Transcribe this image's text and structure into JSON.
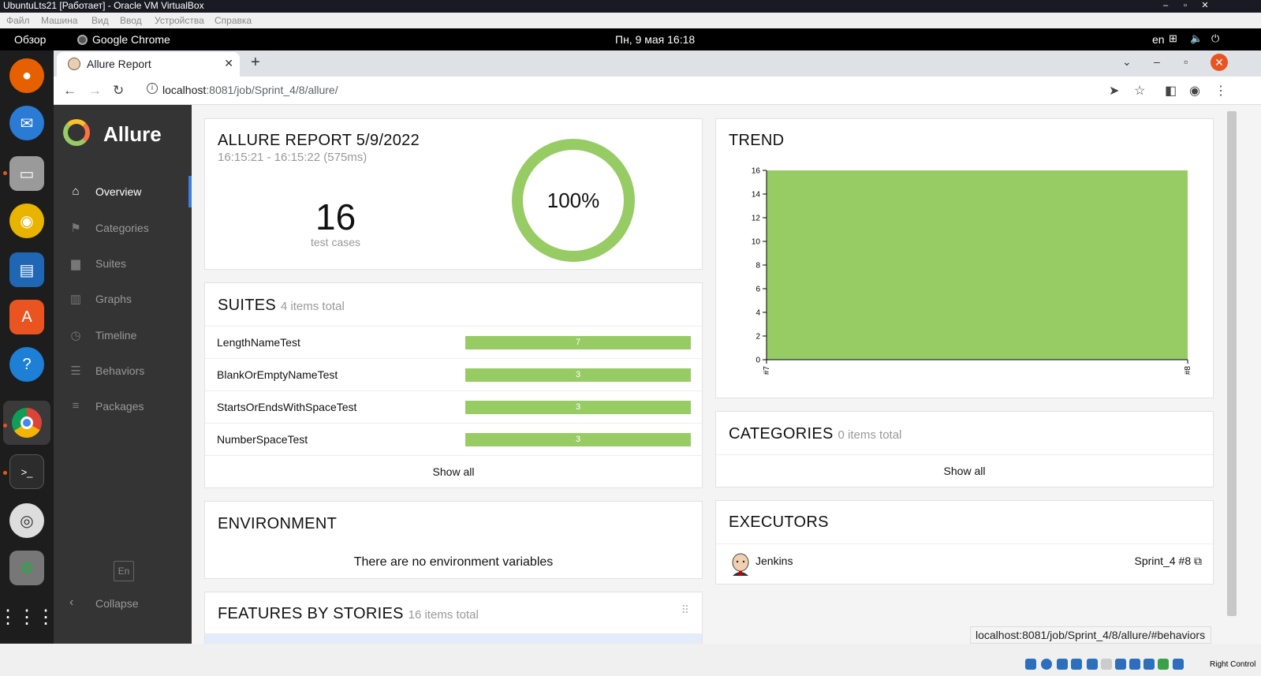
{
  "vbox": {
    "title": "UbuntuLts21 [Работает] - Oracle VM VirtualBox",
    "menu": [
      "Файл",
      "Машина",
      "Вид",
      "Ввод",
      "Устройства",
      "Справка"
    ],
    "right_control": "Right Control"
  },
  "gnome": {
    "overview": "Обзор",
    "app_name": "Google Chrome",
    "clock": "Пн, 9 мая  16:18",
    "lang": "en"
  },
  "dock": {
    "apps": [
      "firefox-icon",
      "thunderbird-icon",
      "files-icon",
      "rhythmbox-icon",
      "writer-icon",
      "software-icon",
      "help-icon",
      "chrome-icon",
      "terminal-icon",
      "dvd-icon",
      "trash-icon",
      "apps-grid-icon"
    ]
  },
  "browser": {
    "tab_title": "Allure Report",
    "url_host": "localhost",
    "url_rest": ":8081/job/Sprint_4/8/allure/",
    "status_url": "localhost:8081/job/Sprint_4/8/allure/#behaviors"
  },
  "sidebar": {
    "brand": "Allure",
    "items": [
      {
        "label": "Overview",
        "icon": "home-icon"
      },
      {
        "label": "Categories",
        "icon": "flag-icon"
      },
      {
        "label": "Suites",
        "icon": "briefcase-icon"
      },
      {
        "label": "Graphs",
        "icon": "bar-chart-icon"
      },
      {
        "label": "Timeline",
        "icon": "clock-icon"
      },
      {
        "label": "Behaviors",
        "icon": "list-icon"
      },
      {
        "label": "Packages",
        "icon": "align-left-icon"
      }
    ],
    "lang_button": "En",
    "collapse": "Collapse"
  },
  "summary": {
    "title": "ALLURE REPORT 5/9/2022",
    "time_range": "16:15:21 - 16:15:22 (575ms)",
    "test_count": "16",
    "test_label": "test cases",
    "pass_percent": "100%",
    "pass_fraction": 1.0
  },
  "suites": {
    "title": "SUITES",
    "total": "4 items total",
    "rows": [
      {
        "name": "LengthNameTest",
        "count": "7"
      },
      {
        "name": "BlankOrEmptyNameTest",
        "count": "3"
      },
      {
        "name": "StartsOrEndsWithSpaceTest",
        "count": "3"
      },
      {
        "name": "NumberSpaceTest",
        "count": "3"
      }
    ],
    "show_all": "Show all"
  },
  "environment": {
    "title": "ENVIRONMENT",
    "message": "There are no environment variables"
  },
  "features": {
    "title": "FEATURES BY STORIES",
    "total": "16 items total"
  },
  "trend": {
    "title": "TREND"
  },
  "categories": {
    "title": "CATEGORIES",
    "total": "0 items total",
    "show_all": "Show all"
  },
  "executors": {
    "title": "EXECUTORS",
    "name": "Jenkins",
    "build": "Sprint_4 #8"
  },
  "chart_data": {
    "type": "area",
    "x": [
      "#7",
      "#8"
    ],
    "series": [
      {
        "values": [
          16,
          16
        ],
        "color": "#97cc64"
      }
    ],
    "ylim": [
      0,
      16
    ],
    "yticks": [
      0,
      2,
      4,
      6,
      8,
      10,
      12,
      14,
      16
    ],
    "title": "TREND",
    "xlabel": "",
    "ylabel": ""
  }
}
